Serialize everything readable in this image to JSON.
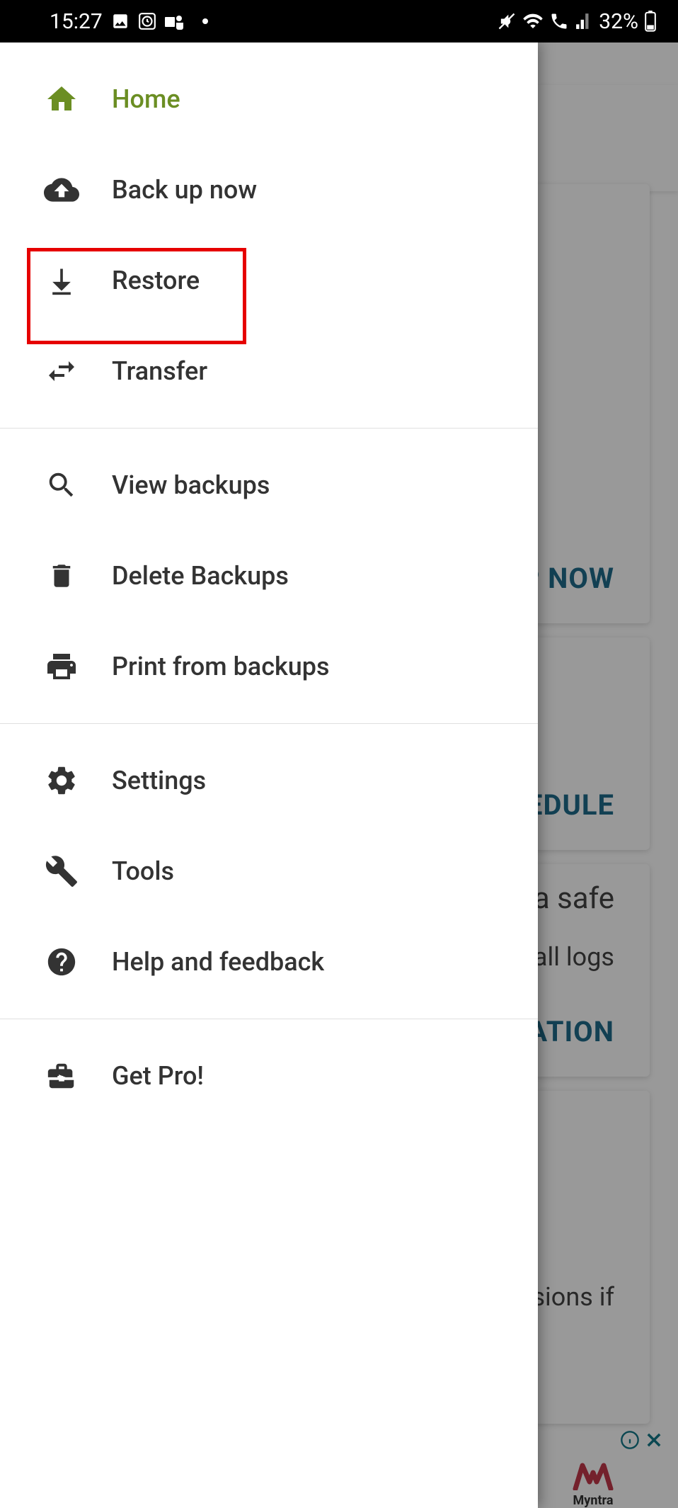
{
  "status": {
    "time": "15:27",
    "battery": "32%"
  },
  "drawer": {
    "section1": [
      {
        "label": "Home",
        "icon": "home",
        "active": true
      },
      {
        "label": "Back up now",
        "icon": "cloud-upload"
      },
      {
        "label": "Restore",
        "icon": "download"
      },
      {
        "label": "Transfer",
        "icon": "swap"
      }
    ],
    "section2": [
      {
        "label": "View backups",
        "icon": "search"
      },
      {
        "label": "Delete Backups",
        "icon": "trash"
      },
      {
        "label": "Print from backups",
        "icon": "print"
      }
    ],
    "section3": [
      {
        "label": "Settings",
        "icon": "gear"
      },
      {
        "label": "Tools",
        "icon": "wrench"
      },
      {
        "label": "Help and feedback",
        "icon": "help"
      }
    ],
    "section4": [
      {
        "label": "Get Pro!",
        "icon": "briefcase"
      }
    ]
  },
  "background": {
    "button1": "BACKUP NOW",
    "button2": "SET SCHEDULE",
    "title3": "Keep your data safe",
    "text3": "Back up your messages, calls and call logs",
    "button3": "SET LOCATION",
    "text4": "Allow app permissions if"
  },
  "ad": {
    "brand": "Myntra"
  }
}
